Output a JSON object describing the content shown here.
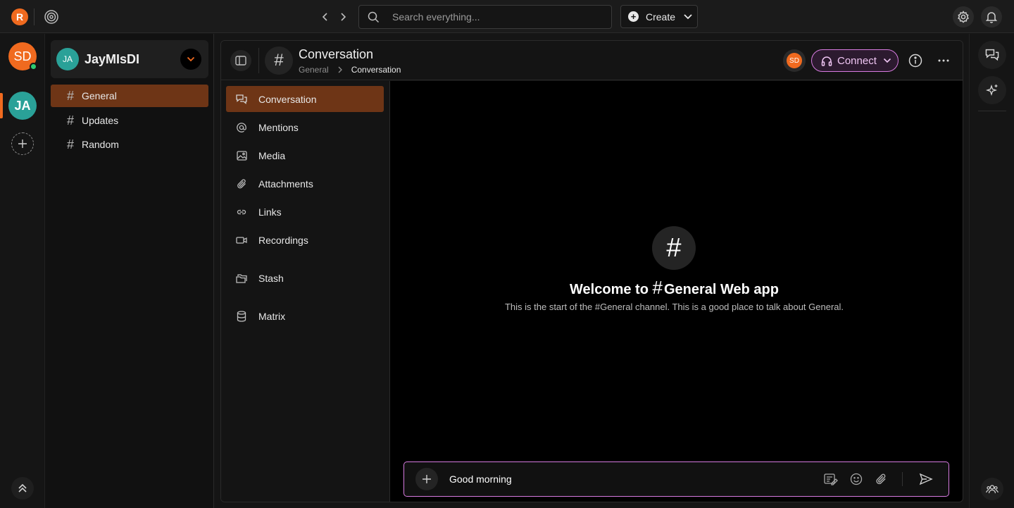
{
  "topbar": {
    "logo_letter": "R",
    "search_placeholder": "Search everything...",
    "create_label": "Create"
  },
  "rail": {
    "user_initials": "SD",
    "workspace_initials": "JA"
  },
  "sidebar": {
    "workspace_initials": "JA",
    "workspace_name": "JayMIsDI",
    "channels": [
      {
        "label": "General",
        "active": true
      },
      {
        "label": "Updates",
        "active": false
      },
      {
        "label": "Random",
        "active": false
      }
    ]
  },
  "header": {
    "title": "Conversation",
    "breadcrumb_parent": "General",
    "breadcrumb_current": "Conversation",
    "member_initials": "SD",
    "connect_label": "Connect"
  },
  "subnav": {
    "items": [
      {
        "label": "Conversation",
        "icon": "chat-bubbles-icon",
        "active": true
      },
      {
        "label": "Mentions",
        "icon": "at-icon"
      },
      {
        "label": "Media",
        "icon": "image-icon"
      },
      {
        "label": "Attachments",
        "icon": "paperclip-icon"
      },
      {
        "label": "Links",
        "icon": "link-icon"
      },
      {
        "label": "Recordings",
        "icon": "video-icon"
      },
      {
        "label": "Stash",
        "icon": "folders-icon"
      },
      {
        "label": "Matrix",
        "icon": "database-icon"
      }
    ]
  },
  "welcome": {
    "hash": "#",
    "title_prefix": "Welcome to ",
    "title_channel": "General Web app",
    "subtitle": "This is the start of the #General channel. This is a good place to talk about General."
  },
  "composer": {
    "value": "Good morning"
  },
  "colors": {
    "accent_orange": "#f06a1f",
    "active_item": "#6e3516",
    "connect_border": "#d77be0",
    "teal_avatar": "#2aa198"
  }
}
